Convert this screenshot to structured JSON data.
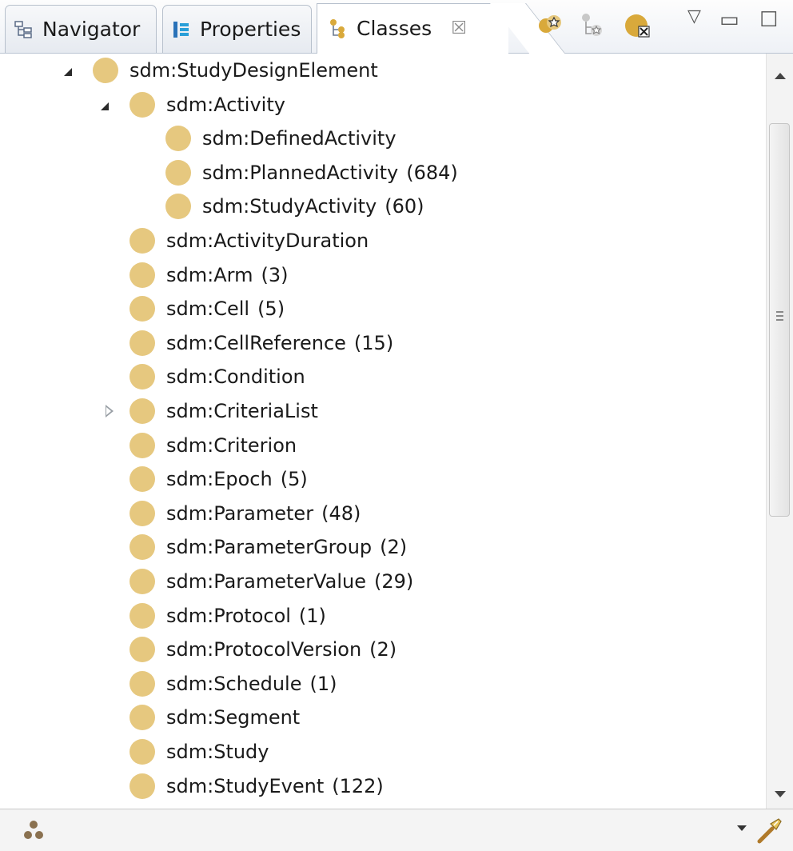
{
  "tabs": {
    "navigator": {
      "label": "Navigator",
      "icon": "navigator-icon"
    },
    "properties": {
      "label": "Properties",
      "icon": "properties-icon"
    },
    "classes": {
      "label": "Classes",
      "icon": "class-hierarchy-icon",
      "close": "☒"
    }
  },
  "toolbar": {
    "icons": [
      "create-class-icon",
      "create-subclass-icon",
      "delete-class-icon"
    ]
  },
  "view_controls": {
    "menu": "▽",
    "minimize": "▭",
    "maximize": "☐"
  },
  "tree": {
    "nodes": [
      {
        "label": "sdm:StudyDesignElement",
        "count": "",
        "level": 0,
        "twisty": "open"
      },
      {
        "label": "sdm:Activity",
        "count": "",
        "level": 1,
        "twisty": "open"
      },
      {
        "label": "sdm:DefinedActivity",
        "count": "",
        "level": 2,
        "twisty": "none"
      },
      {
        "label": "sdm:PlannedActivity",
        "count": "(684)",
        "level": 2,
        "twisty": "none"
      },
      {
        "label": "sdm:StudyActivity",
        "count": "(60)",
        "level": 2,
        "twisty": "none"
      },
      {
        "label": "sdm:ActivityDuration",
        "count": "",
        "level": 1,
        "twisty": "none"
      },
      {
        "label": "sdm:Arm",
        "count": "(3)",
        "level": 1,
        "twisty": "none"
      },
      {
        "label": "sdm:Cell",
        "count": "(5)",
        "level": 1,
        "twisty": "none"
      },
      {
        "label": "sdm:CellReference",
        "count": "(15)",
        "level": 1,
        "twisty": "none"
      },
      {
        "label": "sdm:Condition",
        "count": "",
        "level": 1,
        "twisty": "none"
      },
      {
        "label": "sdm:CriteriaList",
        "count": "",
        "level": 1,
        "twisty": "closed"
      },
      {
        "label": "sdm:Criterion",
        "count": "",
        "level": 1,
        "twisty": "none"
      },
      {
        "label": "sdm:Epoch",
        "count": "(5)",
        "level": 1,
        "twisty": "none"
      },
      {
        "label": "sdm:Parameter",
        "count": "(48)",
        "level": 1,
        "twisty": "none"
      },
      {
        "label": "sdm:ParameterGroup",
        "count": "(2)",
        "level": 1,
        "twisty": "none"
      },
      {
        "label": "sdm:ParameterValue",
        "count": "(29)",
        "level": 1,
        "twisty": "none"
      },
      {
        "label": "sdm:Protocol",
        "count": "(1)",
        "level": 1,
        "twisty": "none"
      },
      {
        "label": "sdm:ProtocolVersion",
        "count": "(2)",
        "level": 1,
        "twisty": "none"
      },
      {
        "label": "sdm:Schedule",
        "count": "(1)",
        "level": 1,
        "twisty": "none"
      },
      {
        "label": "sdm:Segment",
        "count": "",
        "level": 1,
        "twisty": "none"
      },
      {
        "label": "sdm:Study",
        "count": "",
        "level": 1,
        "twisty": "none"
      },
      {
        "label": "sdm:StudyEvent",
        "count": "(122)",
        "level": 1,
        "twisty": "none"
      }
    ]
  },
  "filter": {
    "value": "",
    "icons": [
      "instance-dots-icon",
      "dropdown-arrow-icon",
      "search-wand-icon"
    ]
  },
  "colors": {
    "class_dot": "#e6c87f",
    "tab_border": "#b7c0cc"
  }
}
